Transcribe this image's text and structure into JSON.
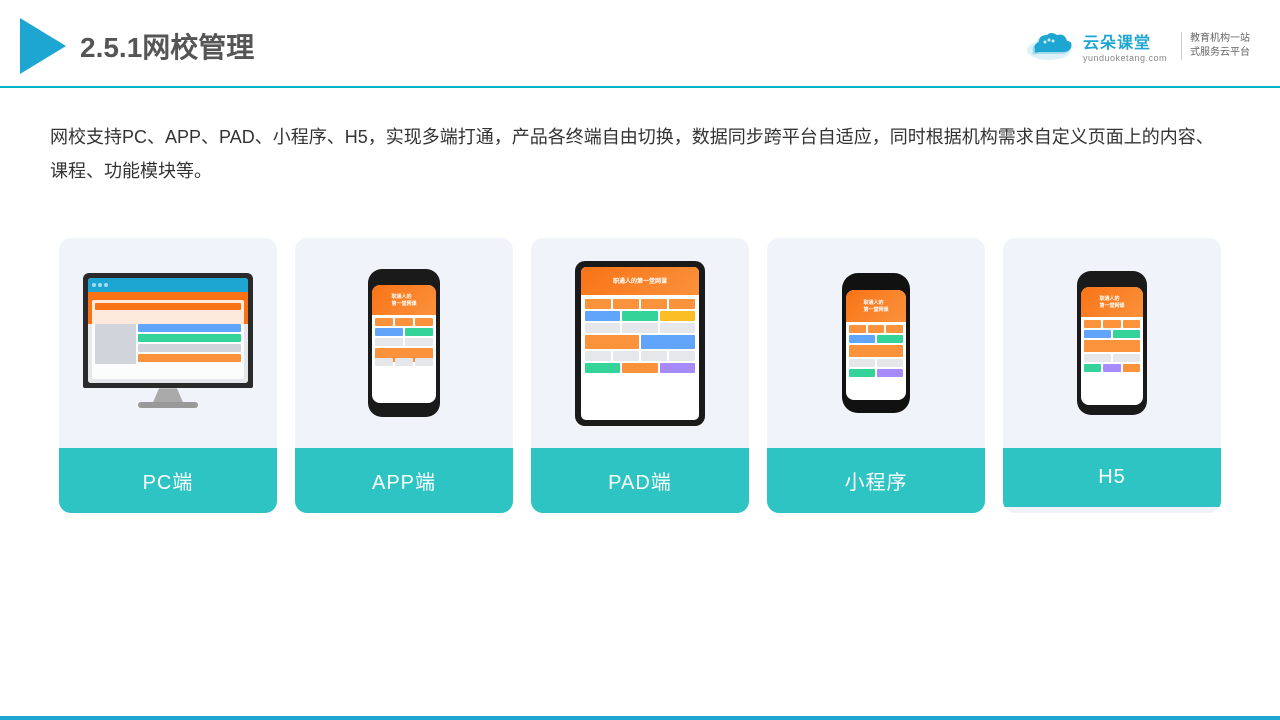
{
  "header": {
    "title_prefix": "2.5.1",
    "title_main": "网校管理"
  },
  "logo": {
    "name": "云朵课堂",
    "url": "yunduoketang.com",
    "slogan": "教育机构一站\n式服务云平台"
  },
  "description": {
    "text": "网校支持PC、APP、PAD、小程序、H5，实现多端打通，产品各终端自由切换，数据同步跨平台自适应，同时根据机构需求自定义页面上的内容、课程、功能模块等。"
  },
  "cards": [
    {
      "id": "pc",
      "label": "PC端"
    },
    {
      "id": "app",
      "label": "APP端"
    },
    {
      "id": "pad",
      "label": "PAD端"
    },
    {
      "id": "mini",
      "label": "小程序"
    },
    {
      "id": "h5",
      "label": "H5"
    }
  ]
}
